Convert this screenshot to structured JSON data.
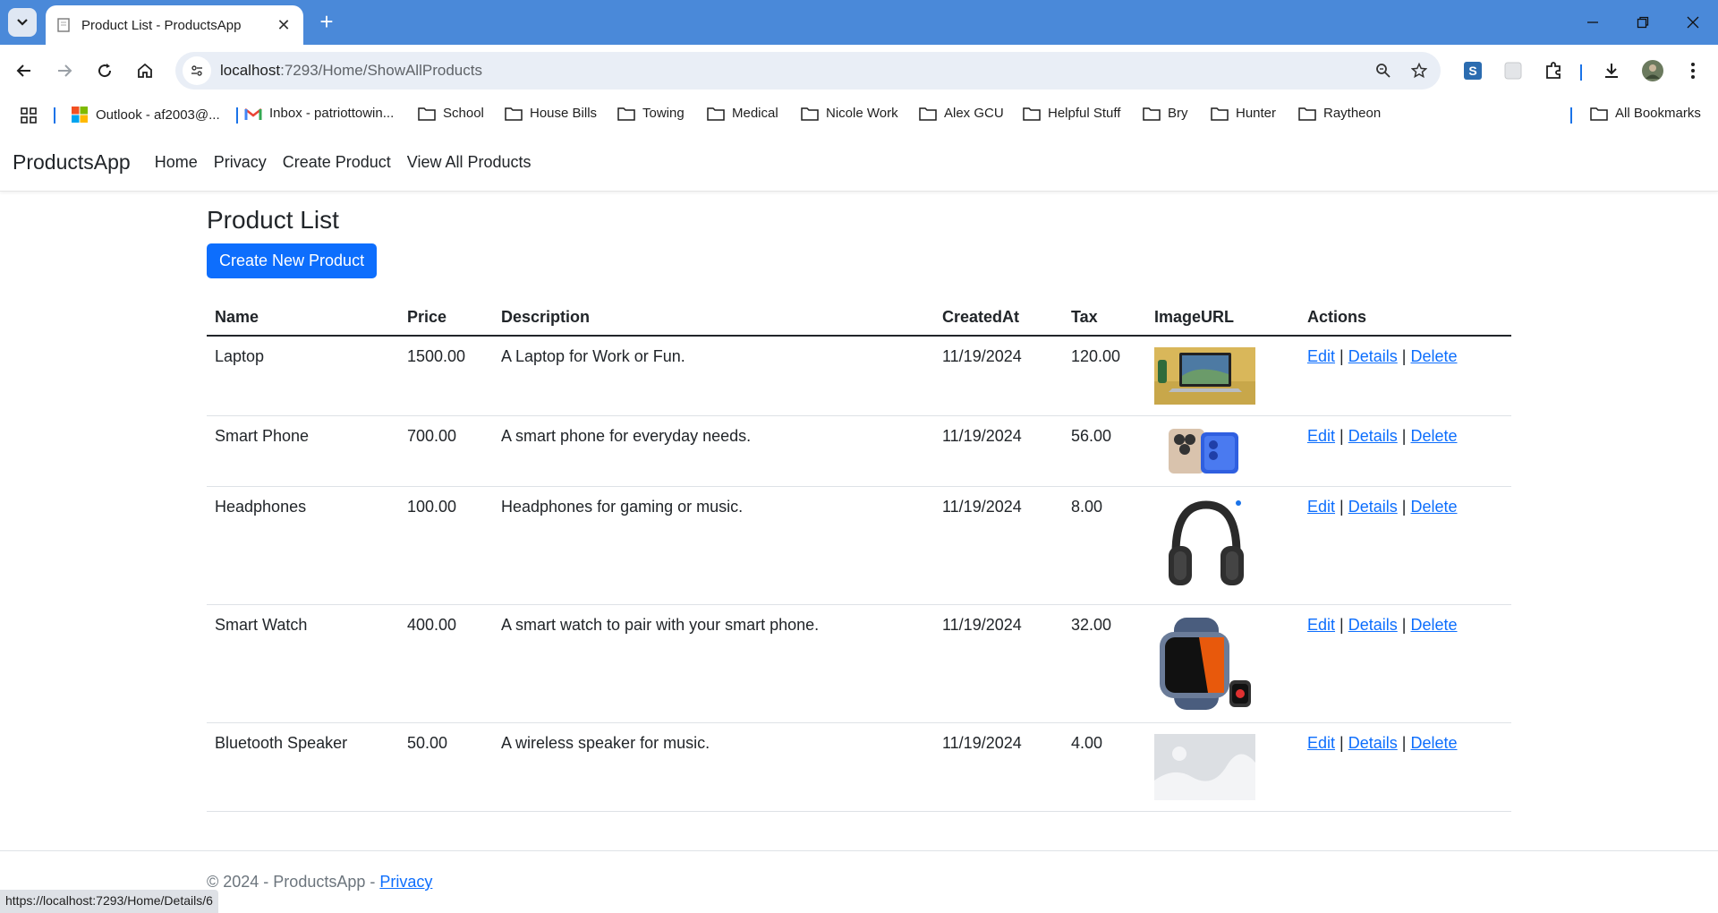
{
  "browser": {
    "tab_title": "Product List - ProductsApp",
    "url_host": "localhost",
    "url_rest": ":7293/Home/ShowAllProducts",
    "bookmarks": [
      {
        "label": "Outlook - af2003@...",
        "icon": "outlook-icon"
      },
      {
        "label": "Inbox - patriottowin...",
        "icon": "gmail-icon"
      },
      {
        "label": "School",
        "icon": "folder-icon"
      },
      {
        "label": "House Bills",
        "icon": "folder-icon"
      },
      {
        "label": "Towing",
        "icon": "folder-icon"
      },
      {
        "label": "Medical",
        "icon": "folder-icon"
      },
      {
        "label": "Nicole Work",
        "icon": "folder-icon"
      },
      {
        "label": "Alex GCU",
        "icon": "folder-icon"
      },
      {
        "label": "Helpful Stuff",
        "icon": "folder-icon"
      },
      {
        "label": "Bry",
        "icon": "folder-icon"
      },
      {
        "label": "Hunter",
        "icon": "folder-icon"
      },
      {
        "label": "Raytheon",
        "icon": "folder-icon"
      }
    ],
    "all_bookmarks": "All Bookmarks",
    "status_url": "https://localhost:7293/Home/Details/6"
  },
  "nav": {
    "brand": "ProductsApp",
    "links": [
      "Home",
      "Privacy",
      "Create Product",
      "View All Products"
    ]
  },
  "main": {
    "title": "Product List",
    "create_button": "Create New Product",
    "columns": [
      "Name",
      "Price",
      "Description",
      "CreatedAt",
      "Tax",
      "ImageURL",
      "Actions"
    ],
    "actions": {
      "edit": "Edit",
      "details": "Details",
      "delete": "Delete",
      "separator": "|"
    },
    "rows": [
      {
        "name": "Laptop",
        "price": "1500.00",
        "description": "A Laptop for Work or Fun.",
        "created": "11/19/2024",
        "tax": "120.00",
        "image": "laptop-image"
      },
      {
        "name": "Smart Phone",
        "price": "700.00",
        "description": "A smart phone for everyday needs.",
        "created": "11/19/2024",
        "tax": "56.00",
        "image": "smartphone-image"
      },
      {
        "name": "Headphones",
        "price": "100.00",
        "description": "Headphones for gaming or music.",
        "created": "11/19/2024",
        "tax": "8.00",
        "image": "headphones-image"
      },
      {
        "name": "Smart Watch",
        "price": "400.00",
        "description": "A smart watch to pair with your smart phone.",
        "created": "11/19/2024",
        "tax": "32.00",
        "image": "smartwatch-image"
      },
      {
        "name": "Bluetooth Speaker",
        "price": "50.00",
        "description": "A wireless speaker for music.",
        "created": "11/19/2024",
        "tax": "4.00",
        "image": "placeholder-image"
      }
    ]
  },
  "footer": {
    "copyright": "© 2024 - ProductsApp - ",
    "privacy": "Privacy"
  },
  "colors": {
    "primary": "#0d6efd",
    "chrome_blue": "#4a89d9"
  }
}
